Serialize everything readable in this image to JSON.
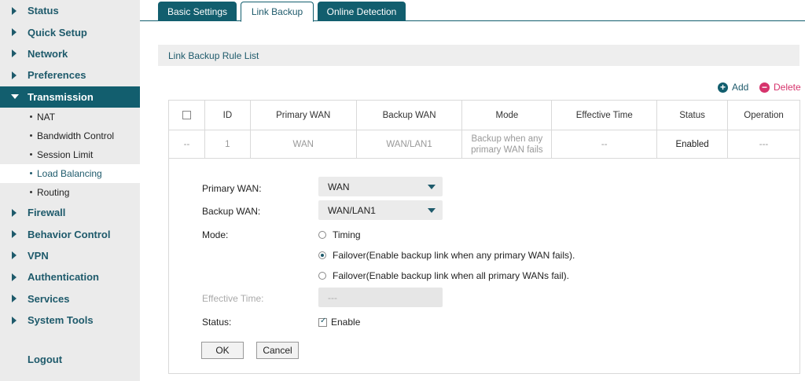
{
  "sidebar": {
    "items": [
      {
        "label": "Status"
      },
      {
        "label": "Quick Setup"
      },
      {
        "label": "Network"
      },
      {
        "label": "Preferences"
      },
      {
        "label": "Transmission"
      },
      {
        "label": "Firewall"
      },
      {
        "label": "Behavior Control"
      },
      {
        "label": "VPN"
      },
      {
        "label": "Authentication"
      },
      {
        "label": "Services"
      },
      {
        "label": "System Tools"
      }
    ],
    "sub_items": [
      {
        "label": "NAT"
      },
      {
        "label": "Bandwidth Control"
      },
      {
        "label": "Session Limit"
      },
      {
        "label": "Load Balancing"
      },
      {
        "label": "Routing"
      }
    ],
    "logout": "Logout"
  },
  "tabs": [
    {
      "label": "Basic Settings"
    },
    {
      "label": "Link Backup"
    },
    {
      "label": "Online Detection"
    }
  ],
  "section": {
    "title": "Link Backup Rule List"
  },
  "actions": {
    "add": "Add",
    "delete": "Delete"
  },
  "table": {
    "headers": [
      "ID",
      "Primary WAN",
      "Backup WAN",
      "Mode",
      "Effective Time",
      "Status",
      "Operation"
    ],
    "row": {
      "select": "--",
      "id": "1",
      "primary_wan": "WAN",
      "backup_wan": "WAN/LAN1",
      "mode_line1": "Backup when any",
      "mode_line2": "primary WAN fails",
      "effective_time": "--",
      "status": "Enabled",
      "operation": "---"
    }
  },
  "form": {
    "primary_wan_label": "Primary WAN:",
    "primary_wan_value": "WAN",
    "backup_wan_label": "Backup WAN:",
    "backup_wan_value": "WAN/LAN1",
    "mode_label": "Mode:",
    "mode_options": [
      "Timing",
      "Failover(Enable backup link when any primary WAN fails).",
      "Failover(Enable backup link when all primary WANs fail)."
    ],
    "mode_selected_index": 1,
    "effective_time_label": "Effective Time:",
    "effective_time_value": "---",
    "status_label": "Status:",
    "status_checkbox_label": "Enable",
    "status_enabled": true,
    "ok_label": "OK",
    "cancel_label": "Cancel"
  },
  "colors": {
    "accent": "#125e6e",
    "accent_text": "#1e5a6b",
    "delete": "#d6336c"
  }
}
